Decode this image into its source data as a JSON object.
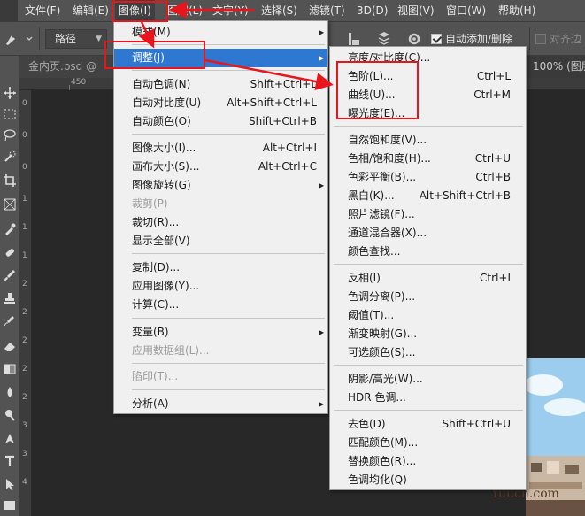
{
  "menubar": {
    "items": [
      {
        "label": "文件(F)"
      },
      {
        "label": "编辑(E)"
      },
      {
        "label": "图像(I)"
      },
      {
        "label": "图层(L)"
      },
      {
        "label": "文字(Y)"
      },
      {
        "label": "选择(S)"
      },
      {
        "label": "滤镜(T)"
      },
      {
        "label": "3D(D)"
      },
      {
        "label": "视图(V)"
      },
      {
        "label": "窗口(W)"
      },
      {
        "label": "帮助(H)"
      }
    ]
  },
  "options_bar": {
    "path_mode": "路径",
    "auto_add_delete": "自动添加/删除",
    "align_edges": "对齐边"
  },
  "document": {
    "tab_title": "金内页.psd @",
    "zoom_label": "100% (图层",
    "ruler_label": "450",
    "vruler_labels": [
      "0",
      "0",
      "0",
      "1",
      "1",
      "1",
      "2",
      "2",
      "2",
      "2",
      "2",
      "3",
      "3",
      "4"
    ]
  },
  "image_menu": {
    "items": [
      {
        "label": "模式(M)",
        "shortcut": "",
        "submenu": true,
        "disabled": false
      },
      {
        "label": "调整(J)",
        "shortcut": "",
        "submenu": true,
        "disabled": false,
        "highlight": true
      },
      {
        "label": "自动色调(N)",
        "shortcut": "Shift+Ctrl+L",
        "submenu": false,
        "disabled": false
      },
      {
        "label": "自动对比度(U)",
        "shortcut": "Alt+Shift+Ctrl+L",
        "submenu": false,
        "disabled": false
      },
      {
        "label": "自动颜色(O)",
        "shortcut": "Shift+Ctrl+B",
        "submenu": false,
        "disabled": false
      },
      {
        "label": "图像大小(I)...",
        "shortcut": "Alt+Ctrl+I",
        "submenu": false,
        "disabled": false
      },
      {
        "label": "画布大小(S)...",
        "shortcut": "Alt+Ctrl+C",
        "submenu": false,
        "disabled": false
      },
      {
        "label": "图像旋转(G)",
        "shortcut": "",
        "submenu": true,
        "disabled": false
      },
      {
        "label": "裁剪(P)",
        "shortcut": "",
        "submenu": false,
        "disabled": true
      },
      {
        "label": "裁切(R)...",
        "shortcut": "",
        "submenu": false,
        "disabled": false
      },
      {
        "label": "显示全部(V)",
        "shortcut": "",
        "submenu": false,
        "disabled": false
      },
      {
        "label": "复制(D)...",
        "shortcut": "",
        "submenu": false,
        "disabled": false
      },
      {
        "label": "应用图像(Y)...",
        "shortcut": "",
        "submenu": false,
        "disabled": false
      },
      {
        "label": "计算(C)...",
        "shortcut": "",
        "submenu": false,
        "disabled": false
      },
      {
        "label": "变量(B)",
        "shortcut": "",
        "submenu": true,
        "disabled": false
      },
      {
        "label": "应用数据组(L)...",
        "shortcut": "",
        "submenu": false,
        "disabled": true
      },
      {
        "label": "陷印(T)...",
        "shortcut": "",
        "submenu": false,
        "disabled": true
      },
      {
        "label": "分析(A)",
        "shortcut": "",
        "submenu": true,
        "disabled": false
      }
    ]
  },
  "adjust_menu": {
    "items": [
      {
        "label": "亮度/对比度(C)...",
        "shortcut": ""
      },
      {
        "label": "色阶(L)...",
        "shortcut": "Ctrl+L"
      },
      {
        "label": "曲线(U)...",
        "shortcut": "Ctrl+M"
      },
      {
        "label": "曝光度(E)...",
        "shortcut": ""
      },
      {
        "label": "自然饱和度(V)...",
        "shortcut": ""
      },
      {
        "label": "色相/饱和度(H)...",
        "shortcut": "Ctrl+U"
      },
      {
        "label": "色彩平衡(B)...",
        "shortcut": "Ctrl+B"
      },
      {
        "label": "黑白(K)...",
        "shortcut": "Alt+Shift+Ctrl+B"
      },
      {
        "label": "照片滤镜(F)...",
        "shortcut": ""
      },
      {
        "label": "通道混合器(X)...",
        "shortcut": ""
      },
      {
        "label": "颜色查找...",
        "shortcut": ""
      },
      {
        "label": "反相(I)",
        "shortcut": "Ctrl+I"
      },
      {
        "label": "色调分离(P)...",
        "shortcut": ""
      },
      {
        "label": "阈值(T)...",
        "shortcut": ""
      },
      {
        "label": "渐变映射(G)...",
        "shortcut": ""
      },
      {
        "label": "可选颜色(S)...",
        "shortcut": ""
      },
      {
        "label": "阴影/高光(W)...",
        "shortcut": ""
      },
      {
        "label": "HDR 色调...",
        "shortcut": ""
      },
      {
        "label": "去色(D)",
        "shortcut": "Shift+Ctrl+U"
      },
      {
        "label": "匹配颜色(M)...",
        "shortcut": ""
      },
      {
        "label": "替换颜色(R)...",
        "shortcut": ""
      },
      {
        "label": "色调均化(Q)",
        "shortcut": ""
      }
    ]
  },
  "watermark": "Yuucn.com",
  "colors": {
    "highlight": "#2f78d2",
    "annotation": "#e8161c",
    "menu_bg": "#f0f0f0",
    "chrome": "#535353"
  }
}
